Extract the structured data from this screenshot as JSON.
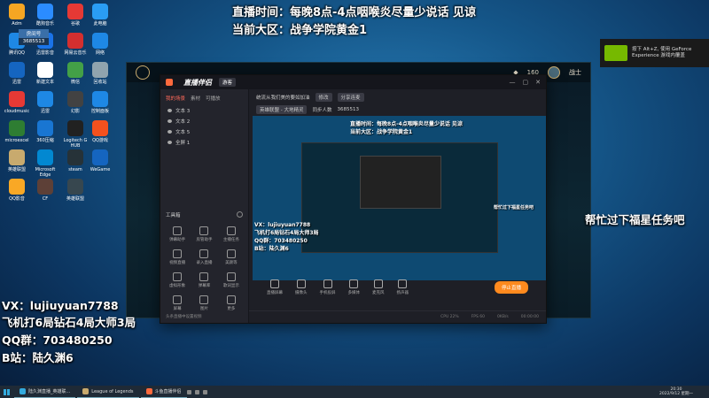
{
  "overlays": {
    "stream_time": "直播时间：每晚8点-4点咽喉炎尽量少说话 见谅",
    "rank": "当前大区：战争学院黄金1",
    "contact_vx": "VX：lujiuyuan7788",
    "service": "飞机打6局钻石4局大师3局",
    "qq_group": "QQ群：703480250",
    "bilibili": "B站：陆久渊6",
    "side_note": "帮忙过下福星任务吧"
  },
  "desktop_icons": [
    {
      "label": "Adm",
      "color": "#f5a623"
    },
    {
      "label": "酷狗音乐",
      "color": "#2b8cff"
    },
    {
      "label": "谷歌",
      "color": "#e53935"
    },
    {
      "label": "此电脑",
      "color": "#2a9df4"
    },
    {
      "label": "腾讯QQ",
      "color": "#1e88e5"
    },
    {
      "label": "迅雷影音",
      "color": "#1a73e8"
    },
    {
      "label": "网易云音乐",
      "color": "#d32f2f"
    },
    {
      "label": "网络",
      "color": "#1e88e5"
    },
    {
      "label": "迅雷",
      "color": "#1565c0"
    },
    {
      "label": "新建文本",
      "color": "#ffffff"
    },
    {
      "label": "微信",
      "color": "#43a047"
    },
    {
      "label": "回收站",
      "color": "#90a4ae"
    },
    {
      "label": "cloudmusic",
      "color": "#e53935"
    },
    {
      "label": "迅雷",
      "color": "#1e88e5"
    },
    {
      "label": "幻影",
      "color": "#424242"
    },
    {
      "label": "控制面板",
      "color": "#1e88e5"
    },
    {
      "label": "microexcel",
      "color": "#2e7d32"
    },
    {
      "label": "360压缩",
      "color": "#1976d2"
    },
    {
      "label": "Logitech G HUB",
      "color": "#212121"
    },
    {
      "label": "QQ游戏",
      "color": "#f4511e"
    },
    {
      "label": "英雄联盟",
      "color": "#c8aa6e"
    },
    {
      "label": "Microsoft Edge",
      "color": "#0288d1"
    },
    {
      "label": "steam",
      "color": "#263238"
    },
    {
      "label": "WeGame",
      "color": "#1565c0"
    },
    {
      "label": "QQ影音",
      "color": "#f9a825"
    },
    {
      "label": "CF",
      "color": "#5d4037"
    },
    {
      "label": "英雄联盟",
      "color": "#37474f"
    }
  ],
  "user_badge": {
    "title": "房间号",
    "number": "3685513"
  },
  "game": {
    "gold": "160",
    "player": "战士"
  },
  "nvidia": {
    "line1": "按下 Alt+Z, 使用 GeForce",
    "line2": "Experience 游戏内覆盖"
  },
  "app": {
    "brand": "直播伴侣",
    "login": "游客",
    "scene_tabs": [
      "我的场景",
      "素材",
      "可播放"
    ],
    "scenes": [
      "文本 3",
      "文本 2",
      "文本 5",
      "全屏 1"
    ],
    "tools_title": "工具箱",
    "tools": [
      "弹幕助手",
      "房管助手",
      "主播任务",
      "视频直播",
      "录入直播",
      "美颜等",
      "虚拟形象",
      "弹幕库",
      "歌词显示",
      "屏幕",
      "图片",
      "更多"
    ],
    "head_title": "统流从我们美的要如加油",
    "head_tag1": "修改",
    "head_tag2": "分享连麦",
    "head_cat": "英雄联盟 - 大地精灵",
    "head_viewers": "同步人数",
    "head_id": "3685513",
    "controls": [
      "直播屏幕",
      "摄像头",
      "手机投屏",
      "多媒体",
      "麦克风",
      "扬声器"
    ],
    "go_live": "停止直播",
    "status_hint": "头条直播中设置视频",
    "status_items": [
      "CPU 22%",
      "FPS 60",
      "0KB/s",
      "00:00:00"
    ]
  },
  "taskbar": {
    "items": [
      "陆久渊直播_英雄联...",
      "League of Legends",
      "斗鱼直播伴侣"
    ],
    "time": "20:30",
    "date": "2022/9/12 星期一"
  }
}
